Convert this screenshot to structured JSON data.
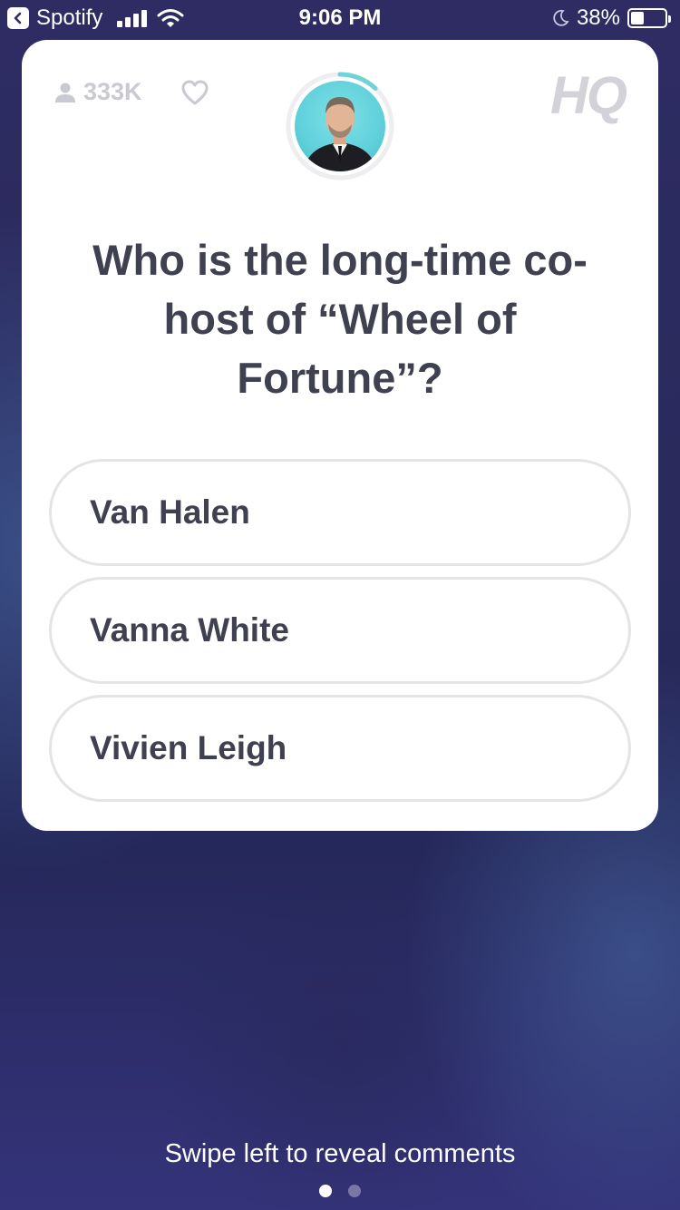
{
  "status_bar": {
    "back_app": "Spotify",
    "time": "9:06 PM",
    "battery": "38%",
    "battery_level": 0.38,
    "icons": [
      "back-arrow-icon",
      "cell-signal-icon",
      "wifi-icon",
      "moon-icon",
      "battery-icon"
    ]
  },
  "card": {
    "viewer_count": "333K",
    "logo": "HQ",
    "question": "Who is the long-time co-host of “Wheel of Fortune”?",
    "answers": [
      {
        "label": "Van Halen"
      },
      {
        "label": "Vanna White"
      },
      {
        "label": "Vivien Leigh"
      }
    ],
    "timer_progress": 0.12,
    "colors": {
      "accent": "#6fd3d8",
      "text": "#3f4050",
      "muted": "#c9c9d2"
    }
  },
  "footer": {
    "hint": "Swipe left to reveal comments",
    "pages": 2,
    "active_page": 1
  }
}
